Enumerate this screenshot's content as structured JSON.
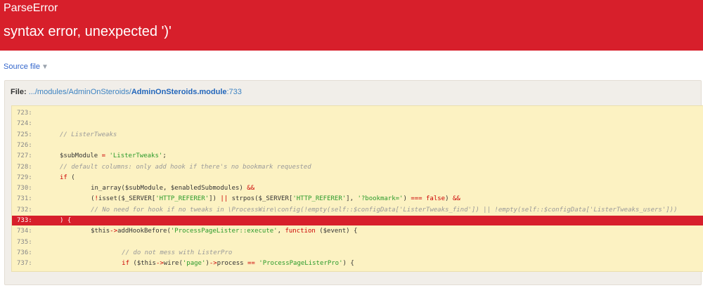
{
  "error": {
    "type": "ParseError",
    "message": "syntax error, unexpected ')'"
  },
  "source_toggle": {
    "label": "Source file",
    "icon": "triangle-down-icon"
  },
  "file": {
    "label": "File:",
    "path": ".../modules/AdminOnSteroids/",
    "module": "AdminOnSteroids.module",
    "line_suffix": ":733"
  },
  "colors": {
    "error_red": "#d71f2b",
    "code_bg": "#fcf2c2",
    "panel_bg": "#f1eee9"
  },
  "code": {
    "highlight_line": 733,
    "lines": [
      {
        "num": "723:",
        "text": ""
      },
      {
        "num": "724:",
        "text": ""
      },
      {
        "num": "725:",
        "text": "            // ListerTweaks"
      },
      {
        "num": "726:",
        "text": ""
      },
      {
        "num": "727:",
        "text": "            $subModule = 'ListerTweaks';"
      },
      {
        "num": "728:",
        "text": "            // default columns: only add hook if there's no bookmark requested"
      },
      {
        "num": "729:",
        "text": "            if ("
      },
      {
        "num": "730:",
        "text": "                in_array($subModule, $enabledSubmodules) &&"
      },
      {
        "num": "731:",
        "text": "                (!isset($_SERVER['HTTP_REFERER']) || strpos($_SERVER['HTTP_REFERER'], '?bookmark=') === false) &&"
      },
      {
        "num": "732:",
        "text": "                // No need for hook if no tweaks in \\ProcessWire\\config(!empty(self::$configData['ListerTweaks_find']) || !empty(self::$configData['ListerTweaks_users']))"
      },
      {
        "num": "733:",
        "text": "            ) {"
      },
      {
        "num": "734:",
        "text": "                $this->addHookBefore('ProcessPageLister::execute', function ($event) {"
      },
      {
        "num": "735:",
        "text": ""
      },
      {
        "num": "736:",
        "text": "                    // do not mess with ListerPro"
      },
      {
        "num": "737:",
        "text": "                    if ($this->wire('page')->process == 'ProcessPageListerPro') {"
      }
    ]
  }
}
